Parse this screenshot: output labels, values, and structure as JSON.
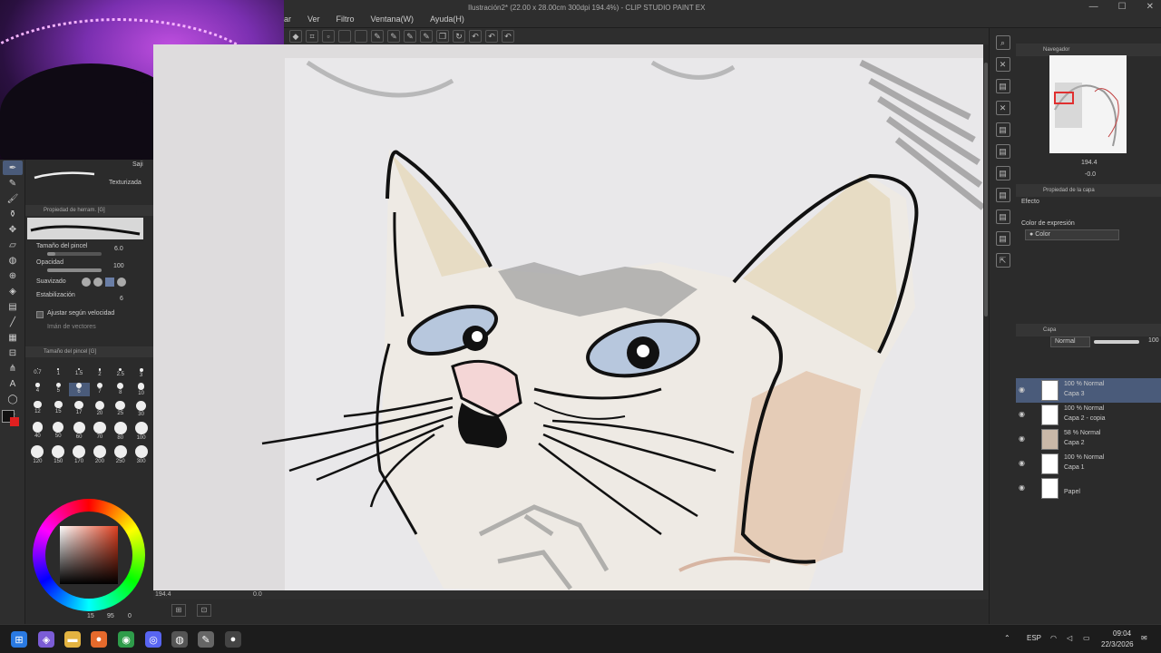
{
  "window": {
    "title": "Ilustración2* (22.00 x 28.00cm 300dpi 194.4%) - CLIP STUDIO PAINT EX",
    "minimize": "—",
    "maximize": "☐",
    "close": "✕"
  },
  "menu": [
    "ar",
    "Ver",
    "Filtro",
    "Ventana(W)",
    "Ayuda(H)"
  ],
  "toolbar_icons": [
    "fill-icon",
    "crop-icon",
    "transform-icon",
    "pen-icon",
    "pen-icon",
    "pen-icon",
    "pen-icon",
    "copy-icon",
    "undo-icon",
    "undo-icon",
    "undo-icon",
    "undo-icon",
    "redo-icon"
  ],
  "left_tools": [
    "pen-tool",
    "pencil-tool",
    "brush-tool",
    "eraser-tool",
    "move-tool",
    "fill-tool",
    "gradient-tool",
    "figure-tool",
    "frame-tool",
    "text-tool",
    "select-tool",
    "lasso-tool",
    "eyedropper-tool",
    "hand-tool",
    "ruler-tool",
    "blend-tool"
  ],
  "brush_panel": {
    "top_label": "Saji",
    "brush_name": "Texturizada"
  },
  "tool_property": {
    "header": "Propiedad de herram. [G]",
    "size_label": "Tamaño del pincel",
    "size_value": "6.0",
    "opacity_label": "Opacidad",
    "opacity_value": "100",
    "opacity_level": 1.0,
    "smoothing_label": "Suavizado",
    "stabilization_label": "Estabilización",
    "stabilization_value": "6",
    "speed_label": "Ajustar según velocidad",
    "vector_label": "Imán de vectores"
  },
  "brush_size_panel": {
    "header": "Tamaño del pincel [G]",
    "sizes": [
      "0.7",
      "1",
      "1.5",
      "2",
      "2.5",
      "3",
      "4",
      "5",
      "6",
      "7",
      "8",
      "10",
      "12",
      "15",
      "17",
      "20",
      "25",
      "30",
      "40",
      "50",
      "60",
      "70",
      "80",
      "100",
      "120",
      "150",
      "170",
      "200",
      "250",
      "300"
    ],
    "selected": "6"
  },
  "color_panel": {
    "fg": "#111111",
    "bg": "#e02020",
    "readout_a": "15",
    "readout_b": "95",
    "readout_c": "0"
  },
  "canvas": {
    "zoom": "194.4",
    "rotation": "0.0"
  },
  "navigator": {
    "header": "Navegador",
    "zoom_value": "194.4",
    "angle_value": "-0.0"
  },
  "layer_property": {
    "header": "Propiedad de la capa",
    "effect_label": "Efecto",
    "expression_label": "Color de expresión",
    "expression_value": "Color"
  },
  "layers_panel": {
    "header": "Capa",
    "blend_mode": "Normal",
    "opacity": "100",
    "layers": [
      {
        "line1": "100 % Normal",
        "line2": "Capa 3"
      },
      {
        "line1": "100 % Normal",
        "line2": "Capa 2 - copia"
      },
      {
        "line1": "58 % Normal",
        "line2": "Capa 2"
      },
      {
        "line1": "100 % Normal",
        "line2": "Capa 1"
      },
      {
        "line1": "",
        "line2": "Papel"
      }
    ]
  },
  "taskbar": {
    "language": "ESP",
    "time": "09:04",
    "date": "22/3/2026"
  }
}
